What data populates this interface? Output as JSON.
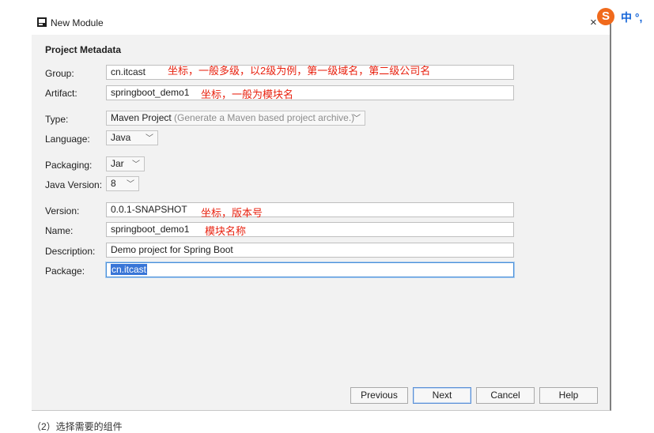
{
  "window": {
    "title": "New Module"
  },
  "section_title": "Project Metadata",
  "fields": {
    "group": {
      "label": "Group:",
      "value": "cn.itcast"
    },
    "artifact": {
      "label": "Artifact:",
      "value": "springboot_demo1"
    },
    "type": {
      "label": "Type:",
      "value": "Maven Project",
      "hint": "(Generate a Maven based project archive.)"
    },
    "language": {
      "label": "Language:",
      "value": "Java"
    },
    "packaging": {
      "label": "Packaging:",
      "value": "Jar"
    },
    "java_version": {
      "label": "Java Version:",
      "value": "8"
    },
    "version": {
      "label": "Version:",
      "value": "0.0.1-SNAPSHOT"
    },
    "name": {
      "label": "Name:",
      "value": "springboot_demo1"
    },
    "description": {
      "label": "Description:",
      "value": "Demo project for Spring Boot"
    },
    "package": {
      "label": "Package:",
      "value": "cn.itcast"
    }
  },
  "annotations": {
    "group": "坐标，一般多级，以2级为例，第一级域名，第二级公司名",
    "artifact": "坐标，一般为模块名",
    "version": "坐标，版本号",
    "name": "模块名称"
  },
  "buttons": {
    "previous": "Previous",
    "next": "Next",
    "cancel": "Cancel",
    "help": "Help"
  },
  "ime": {
    "logo": "S",
    "text": "中 °,"
  },
  "caption": "（2）选择需要的组件",
  "colors": {
    "annotation": "#e8210f",
    "selection": "#3875d7",
    "ime_logo": "#f06a1c",
    "ime_text": "#1565d8"
  }
}
